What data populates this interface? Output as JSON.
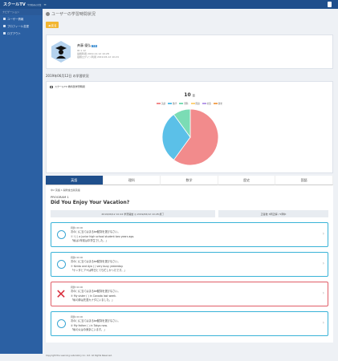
{
  "header": {
    "logo": "スクールTV",
    "logo_sub": "学習動画の授業",
    "menu_icon": "hamburger-icon",
    "user_name": ""
  },
  "sidebar": {
    "heading": "ナビゲーション",
    "items": [
      {
        "label": "ユーザー情報",
        "icon": "user-icon"
      },
      {
        "label": "プロフィール変更",
        "icon": "edit-icon"
      },
      {
        "label": "ログアウト",
        "icon": "logout-icon"
      }
    ]
  },
  "page": {
    "title": "ユーザーの学習時間状況",
    "back_button": "◀ 戻る"
  },
  "profile": {
    "name": "斉藤 優弘",
    "badge": "生徒",
    "id": "ID:1 12",
    "lines": [
      "最終利用 2019.12.12 10:28",
      "最終ログイン利用 2019.06.12 10:24"
    ]
  },
  "section_title": "2019年06月12日 の学習状況",
  "chart_label": "スクールTV 教科別学習時間",
  "chart_data": {
    "type": "pie",
    "title": "10",
    "title_unit": "回",
    "categories": [
      "英語",
      "数学",
      "理科",
      "国語",
      "社会",
      "歴史"
    ],
    "values": [
      6,
      3,
      1,
      0,
      0,
      0
    ],
    "colors": [
      "#f28b8c",
      "#5bc0e8",
      "#7bdcb5",
      "#ffd37a",
      "#b79be8",
      "#f2a65a"
    ]
  },
  "tabs": [
    "英語",
    "理科",
    "数学",
    "歴史",
    "国語"
  ],
  "active_tab": 0,
  "lesson": {
    "crumb": "中2 英語 1   開隆堂出版英語",
    "program": "PROGRAM 1",
    "title": "Did You Enjoy Your Vacation?",
    "info_left": "2019/06/12 10:24 学習開始  ◎ 2019/06/12 10:28 終了",
    "info_right": "正答数  3問正解 / 5問中"
  },
  "questions": [
    {
      "result": "correct",
      "meta": "問題1   00:00",
      "prompt": "次の(   )に当てはまるbe動詞を選びなさい。",
      "answer": "①  I (   ) a junior high school student two years ago.",
      "jp": "「私は2年前は中学生でした。」"
    },
    {
      "result": "correct",
      "meta": "問題2   00:00",
      "prompt": "次の(   )に当てはまるbe動詞を選びなさい。",
      "answer": "②  Kenta and Aya (   ) very busy yesterday.",
      "jp": "「ケンタとアヤは昨日とても忙しかったです。」"
    },
    {
      "result": "wrong",
      "meta": "問題3   00:00",
      "prompt": "次の(   )に当てはまるbe動詞を選びなさい。",
      "answer": "③  My sister (   ) in Canada last week.",
      "jp": "「私の姉は先週カナダにいました。」"
    },
    {
      "result": "correct",
      "meta": "問題4   00:00",
      "prompt": "次の(   )に当てはまるbe動詞を選びなさい。",
      "answer": "④  My father (   ) in Tokyo now.",
      "jp": "「私の父は今東京にいます。」"
    }
  ],
  "footer": "Copyright the Learning Laboratory Inc. Ltd. All Rights Reserved."
}
